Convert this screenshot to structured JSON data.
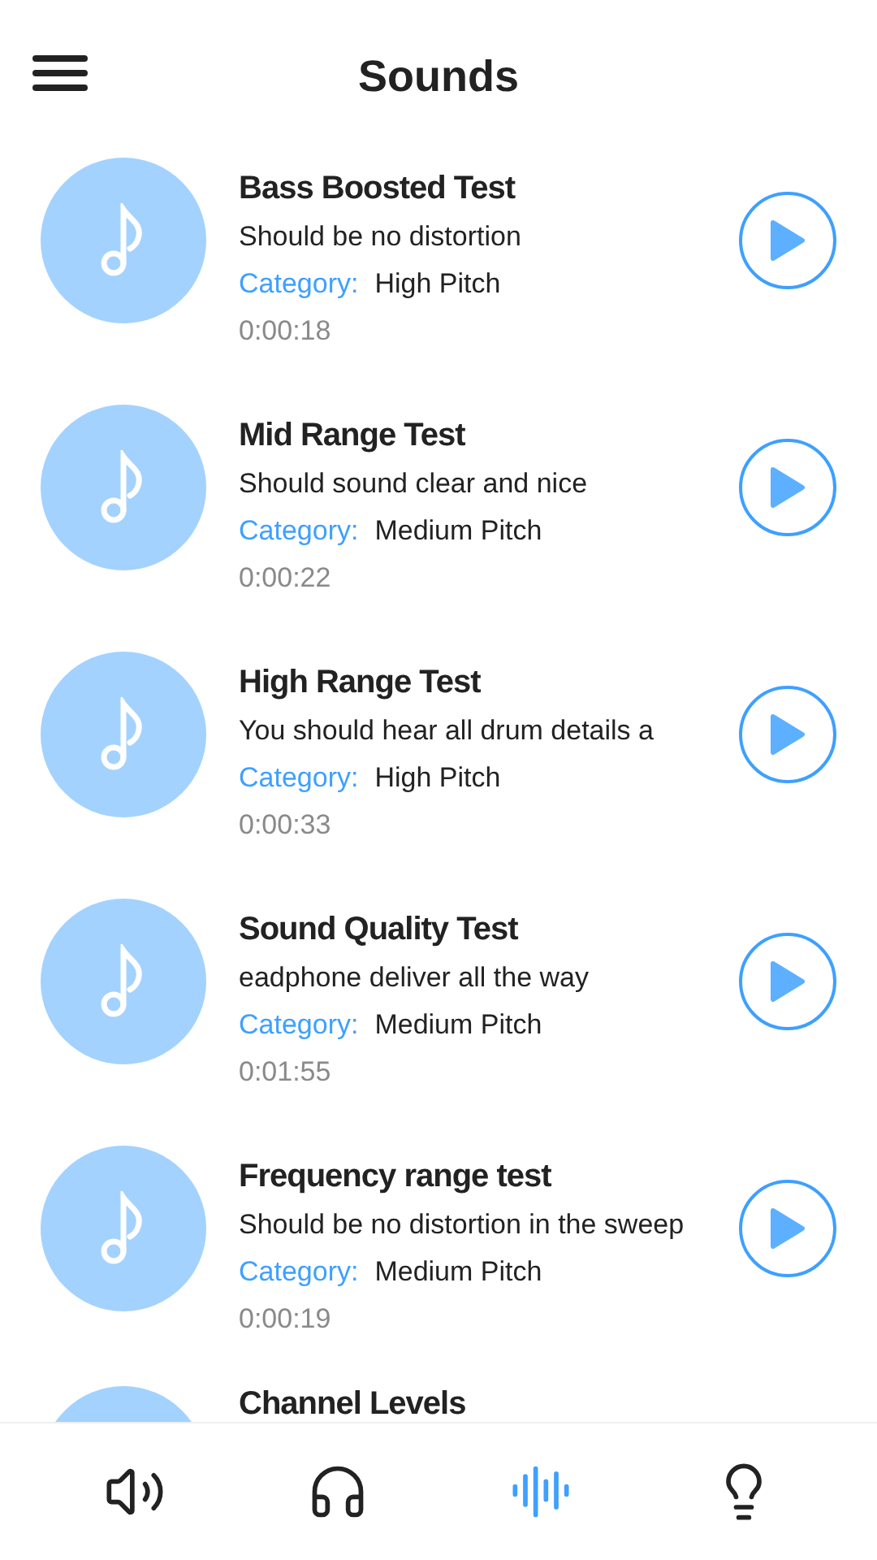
{
  "header": {
    "title": "Sounds"
  },
  "sounds": [
    {
      "title": "Bass Boosted Test",
      "description": "Should be no distortion",
      "category_label": "Category:",
      "category": "High Pitch",
      "duration": "0:00:18"
    },
    {
      "title": "Mid Range Test",
      "description": "Should sound clear and nice",
      "category_label": "Category:",
      "category": "Medium Pitch",
      "duration": "0:00:22"
    },
    {
      "title": "High Range Test",
      "description": "You should hear all drum details a",
      "category_label": "Category:",
      "category": "High Pitch",
      "duration": "0:00:33"
    },
    {
      "title": "Sound Quality Test",
      "description": "eadphone deliver all the way",
      "category_label": "Category:",
      "category": "Medium Pitch",
      "duration": "0:01:55"
    },
    {
      "title": "Frequency range test",
      "description": "Should be no distortion in the sweep",
      "category_label": "Category:",
      "category": "Medium Pitch",
      "duration": "0:00:19"
    },
    {
      "title": "Channel Levels"
    }
  ],
  "nav": [
    {
      "kind": "speaker",
      "selected": false
    },
    {
      "kind": "headphones",
      "selected": false
    },
    {
      "kind": "wave",
      "selected": true
    },
    {
      "kind": "bulb",
      "selected": false
    }
  ]
}
